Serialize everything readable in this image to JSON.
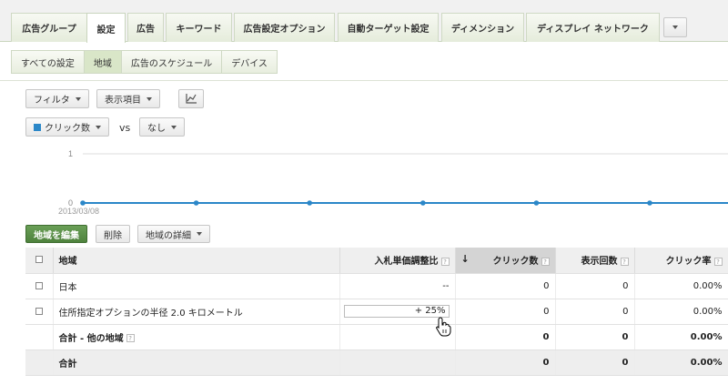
{
  "tabs": [
    {
      "label": "広告グループ",
      "active": false
    },
    {
      "label": "設定",
      "active": true
    },
    {
      "label": "広告",
      "active": false
    },
    {
      "label": "キーワード",
      "active": false
    },
    {
      "label": "広告設定オプション",
      "active": false
    },
    {
      "label": "自動ターゲット設定",
      "active": false
    },
    {
      "label": "ディメンション",
      "active": false
    },
    {
      "label": "ディスプレイ ネットワーク",
      "active": false
    }
  ],
  "subtabs": [
    {
      "label": "すべての設定",
      "active": false
    },
    {
      "label": "地域",
      "active": true
    },
    {
      "label": "広告のスケジュール",
      "active": false
    },
    {
      "label": "デバイス",
      "active": false
    }
  ],
  "toolbar": {
    "filter": "フィルタ",
    "columns": "表示項目"
  },
  "metrics": {
    "primary": "クリック数",
    "vs": "vs",
    "secondary": "なし"
  },
  "chart_data": {
    "type": "line",
    "x": [
      "2013/03/08",
      "",
      "",
      "",
      "",
      "",
      ""
    ],
    "y_ticks": [
      "1",
      "0"
    ],
    "ylim": [
      0,
      1
    ],
    "series": [
      {
        "values": [
          0,
          0,
          0,
          0,
          0,
          0,
          0
        ]
      }
    ],
    "x_start_label": "2013/03/08",
    "color": "#2b87c8",
    "grid": true
  },
  "actions": {
    "edit": "地域を編集",
    "delete": "削除",
    "details": "地域の詳細"
  },
  "table": {
    "headers": {
      "region": "地域",
      "bid": "入札単価調整比",
      "clicks": "クリック数",
      "impressions": "表示回数",
      "ctr": "クリック率"
    },
    "help_glyph": "?",
    "rows": [
      {
        "region": "日本",
        "bid": "--",
        "clicks": "0",
        "impressions": "0",
        "ctr": "0.00%"
      },
      {
        "region": "住所指定オプションの半径 2.0 キロメートル",
        "bid": "+ 25%",
        "clicks": "0",
        "impressions": "0",
        "ctr": "0.00%"
      }
    ],
    "subtotal": {
      "label": "合計 - 他の地域",
      "clicks": "0",
      "impressions": "0",
      "ctr": "0.00%"
    },
    "total": {
      "label": "合計",
      "clicks": "0",
      "impressions": "0",
      "ctr": "0.00%"
    }
  }
}
